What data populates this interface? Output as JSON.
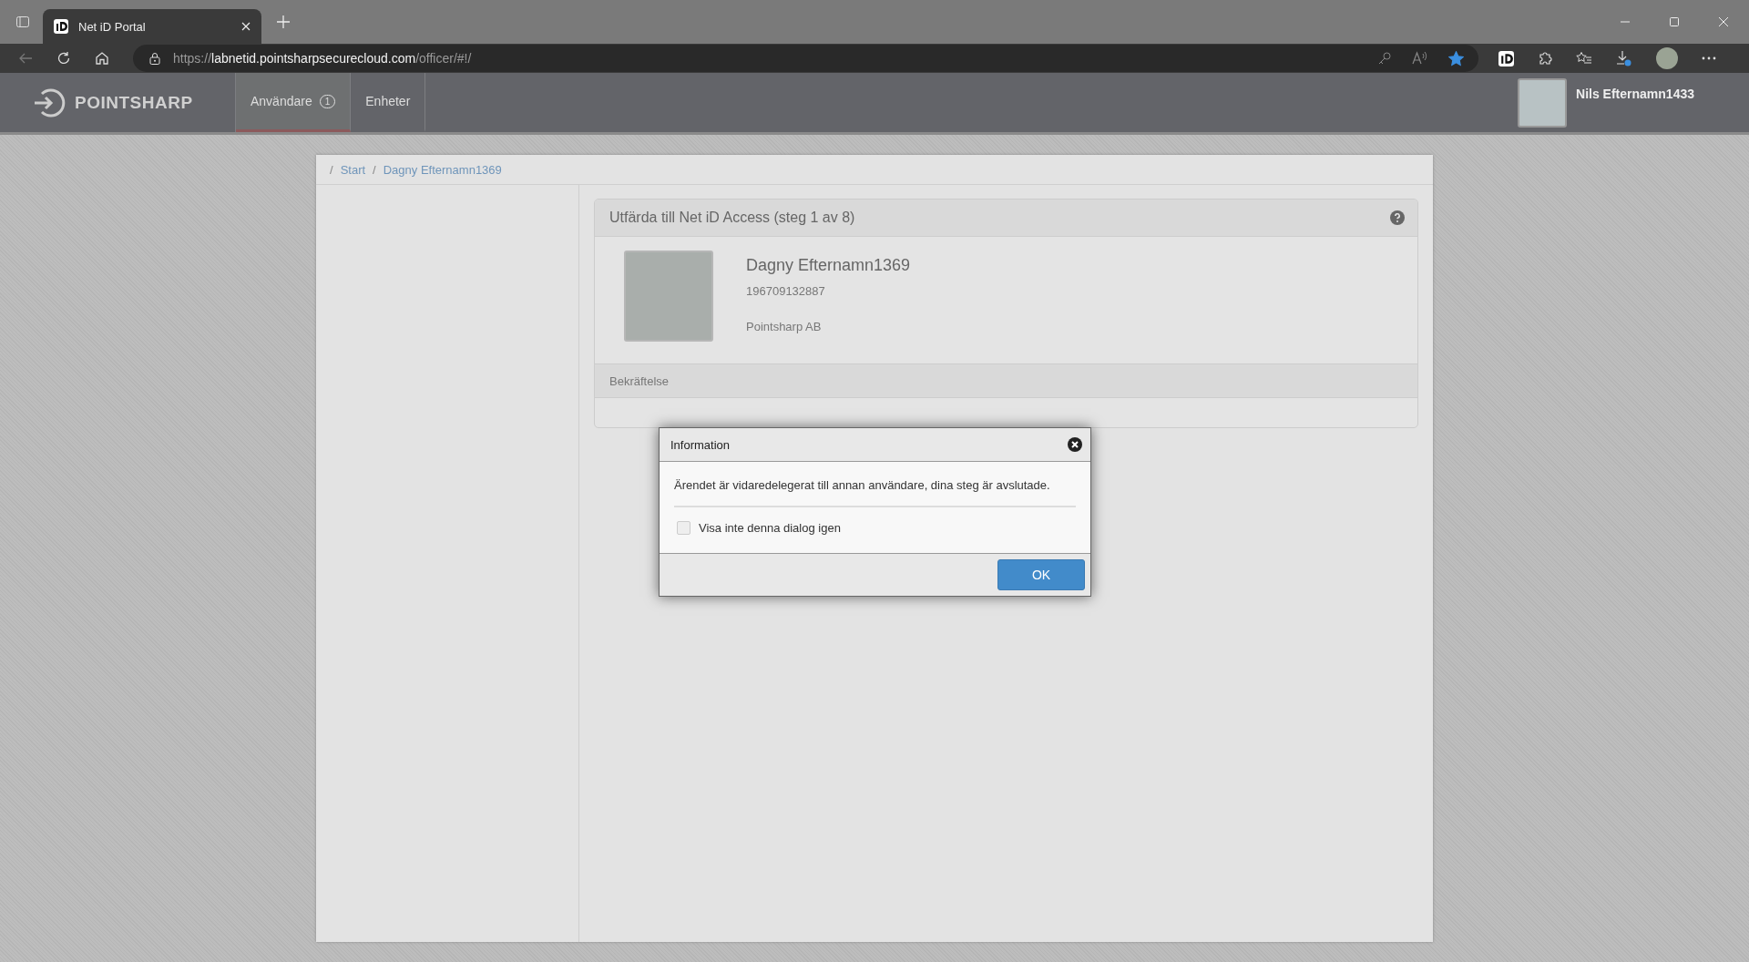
{
  "browser": {
    "tab_title": "Net iD Portal",
    "url": {
      "scheme": "https://",
      "host": "labnetid.pointsharpsecurecloud.com",
      "path": "/officer/#!/"
    },
    "favorite": true
  },
  "header": {
    "logo": "POINTSHARP",
    "nav": [
      {
        "label": "Användare",
        "badge": "1",
        "selected": true
      },
      {
        "label": "Enheter",
        "selected": false
      }
    ],
    "user_name": "Nils Efternamn1433"
  },
  "breadcrumb": [
    {
      "separator": "/",
      "label": "Start"
    },
    {
      "separator": "/",
      "label": "Dagny Efternamn1369"
    }
  ],
  "panel": {
    "title": "Utfärda till Net iD Access (steg 1 av 8)",
    "person": {
      "name": "Dagny Efternamn1369",
      "id_number": "196709132887",
      "organization": "Pointsharp AB"
    },
    "section": "Bekräftelse"
  },
  "dialog": {
    "title": "Information",
    "message": "Ärendet är vidaredelegerat till annan användare, dina steg är avslutade.",
    "checkbox": {
      "label": "Visa inte denna dialog igen",
      "checked": false
    },
    "button": "OK"
  }
}
